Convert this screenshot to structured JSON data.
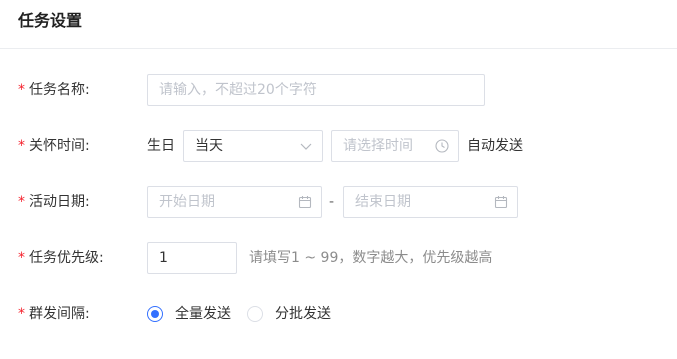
{
  "header": {
    "title": "任务设置"
  },
  "form": {
    "required_mark": "*",
    "task_name": {
      "label": "任务名称:",
      "placeholder": "请输入，不超过20个字符"
    },
    "care_time": {
      "label": "关怀时间:",
      "prefix": "生日",
      "day_select_value": "当天",
      "time_placeholder": "请选择时间",
      "suffix": "自动发送"
    },
    "activity_date": {
      "label": "活动日期:",
      "start_placeholder": "开始日期",
      "separator": "-",
      "end_placeholder": "结束日期"
    },
    "priority": {
      "label": "任务优先级:",
      "value": "1",
      "hint": "请填写1 ~ 99，数字越大，优先级越高"
    },
    "send_interval": {
      "label": "群发间隔:",
      "options": [
        {
          "label": "全量发送",
          "checked": true
        },
        {
          "label": "分批发送",
          "checked": false
        }
      ]
    }
  },
  "icons": {
    "dropdown": "chevron-down-icon",
    "time": "clock-icon",
    "date": "calendar-icon"
  },
  "colors": {
    "required": "#f5222d",
    "accent": "#3370ff",
    "border": "#dcdfe6",
    "placeholder": "#c0c4cc"
  }
}
